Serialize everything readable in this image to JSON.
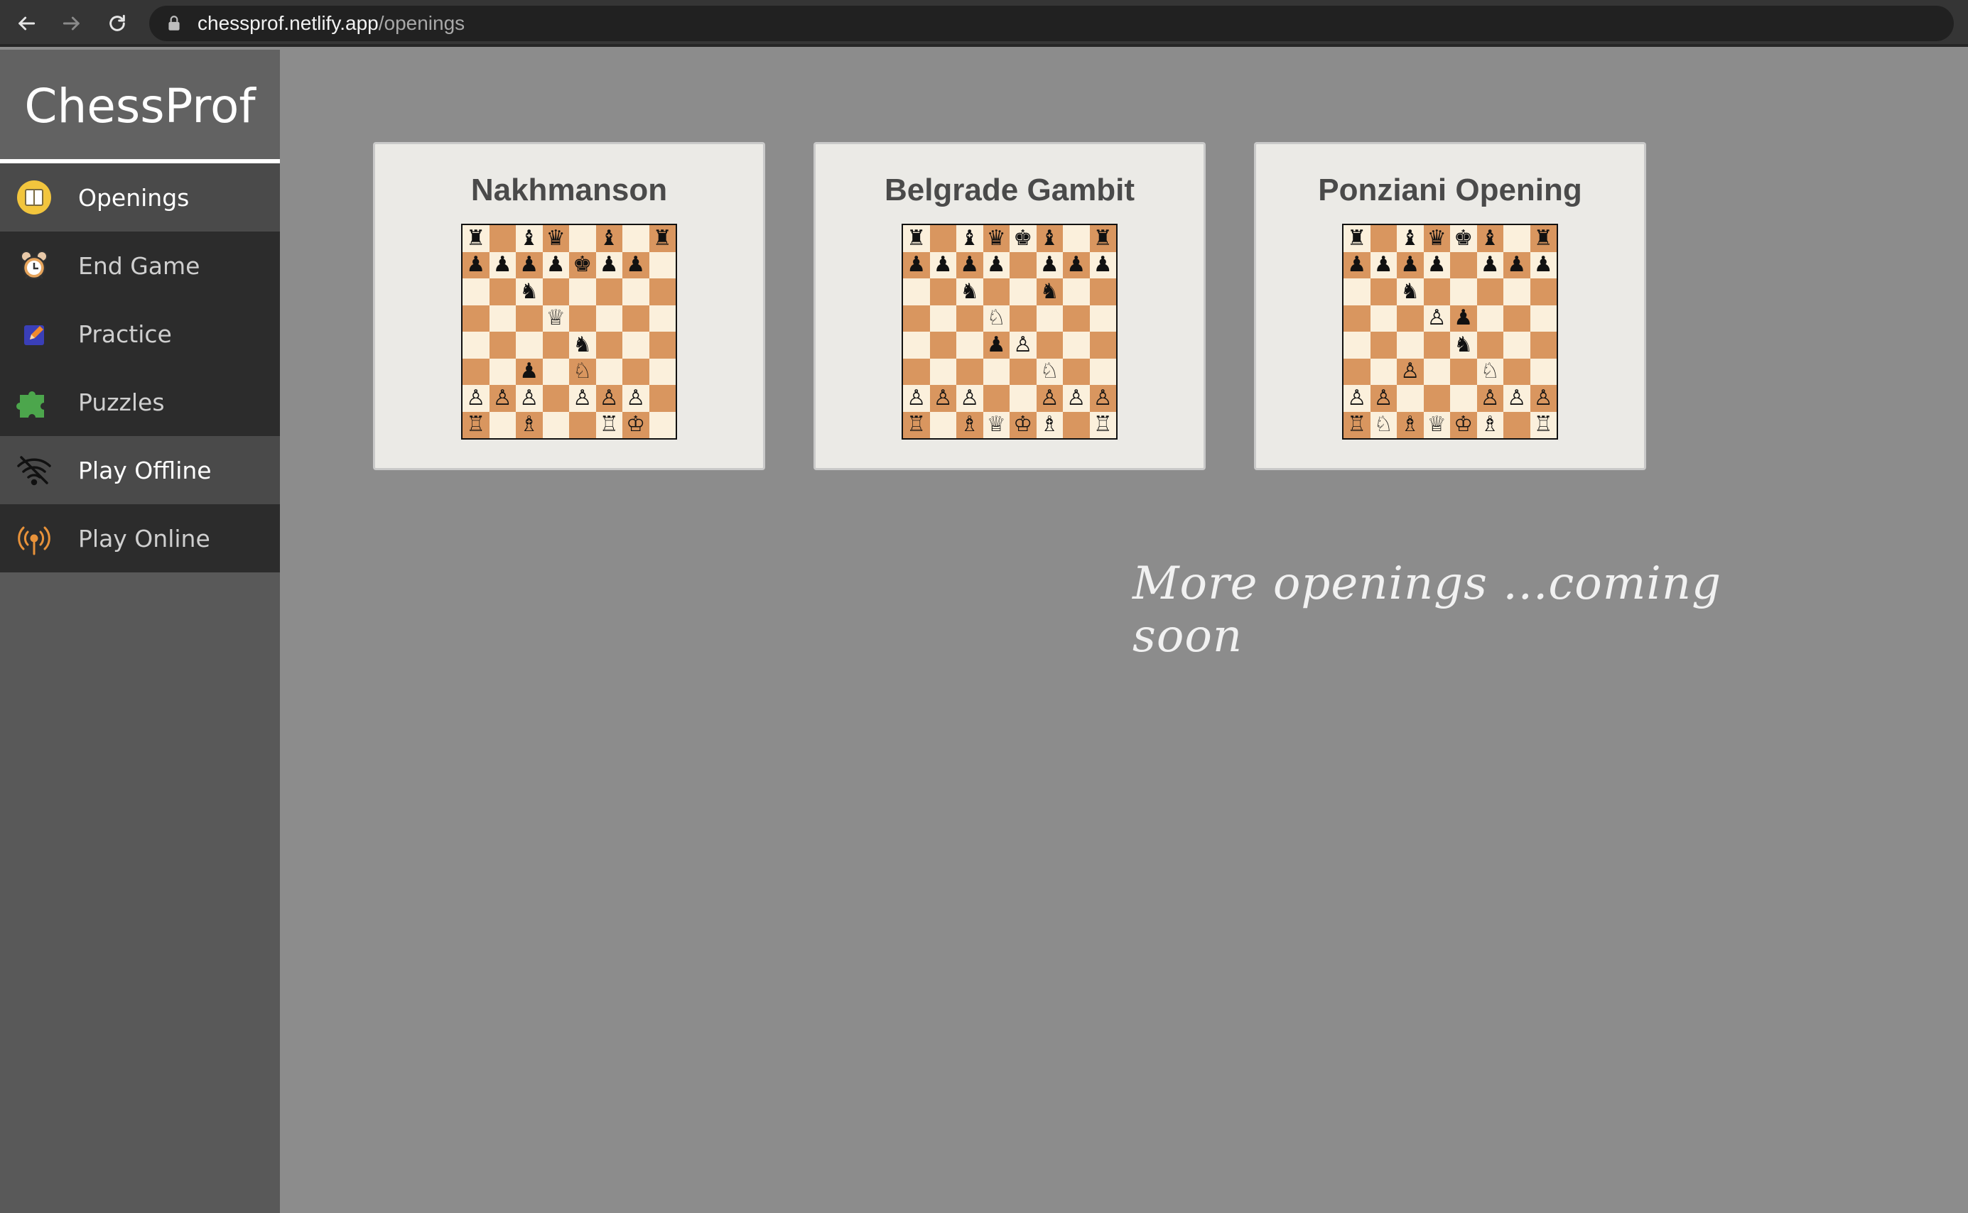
{
  "browser": {
    "url_host": "chessprof.netlify.app",
    "url_path": "/openings"
  },
  "brand": {
    "title": "ChessProf"
  },
  "sidebar": {
    "items": [
      {
        "label": "Openings",
        "icon": "book-icon",
        "state": "active"
      },
      {
        "label": "End Game",
        "icon": "alarm-clock-icon",
        "state": "normal"
      },
      {
        "label": "Practice",
        "icon": "pencil-icon",
        "state": "normal"
      },
      {
        "label": "Puzzles",
        "icon": "puzzle-icon",
        "state": "normal"
      },
      {
        "label": "Play Offline",
        "icon": "wifi-off-icon",
        "state": "hover"
      },
      {
        "label": "Play Online",
        "icon": "antenna-icon",
        "state": "normal"
      }
    ]
  },
  "openings": [
    {
      "title": "Nakhmanson",
      "board": [
        "r.bq.b.r",
        "ppppkpp.",
        "..n.....",
        "...Q....",
        "....n...",
        "..p.N...",
        "PPP.PPP.",
        "R.B..RK."
      ]
    },
    {
      "title": "Belgrade Gambit",
      "board": [
        "r.bqkb.r",
        "pppp.ppp",
        "..n..n..",
        "...N....",
        "...pP...",
        ".....N..",
        "PPP..PPP",
        "R.BQKB.R"
      ]
    },
    {
      "title": "Ponziani Opening",
      "board": [
        "r.bqkb.r",
        "pppp.ppp",
        "..n.....",
        "...Pp...",
        "....n...",
        "..P..N..",
        "PP...PPP",
        "RNBQKB.R"
      ]
    }
  ],
  "footer_text": "More openings ...coming soon",
  "colors": {
    "light_square": "#fbf0dc",
    "dark_square": "#d9965f",
    "highlight_yellow": "#f2d58a",
    "highlight_purple": "#c4b1c4",
    "highlight_blue": "#7b8fd1"
  }
}
